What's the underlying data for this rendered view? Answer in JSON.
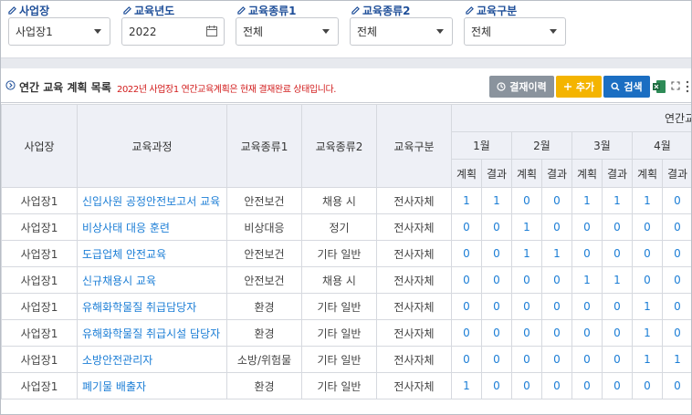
{
  "filters": [
    {
      "label": "사업장",
      "value": "사업장1",
      "type": "select"
    },
    {
      "label": "교육년도",
      "value": "2022",
      "type": "date"
    },
    {
      "label": "교육종류1",
      "value": "전체",
      "type": "select"
    },
    {
      "label": "교육종류2",
      "value": "전체",
      "type": "select"
    },
    {
      "label": "교육구분",
      "value": "전체",
      "type": "select"
    }
  ],
  "section": {
    "title": "연간 교육 계획 목록",
    "note": "2022년 사업장1 연간교육계획은 현재 결재완료 상태입니다."
  },
  "buttons": {
    "history": "결재이력",
    "add": "추가",
    "search": "검색"
  },
  "table": {
    "headers": {
      "site": "사업장",
      "course": "교육과정",
      "type1": "교육종류1",
      "type2": "교육종류2",
      "category": "교육구분",
      "annual": "연간교"
    },
    "months": [
      "1월",
      "2월",
      "3월",
      "4월"
    ],
    "sub": {
      "plan": "계획",
      "result": "결과"
    },
    "rows": [
      {
        "site": "사업장1",
        "course": "신입사원 공정안전보고서 교육",
        "type1": "안전보건",
        "type2": "채용 시",
        "category": "전사자체",
        "vals": [
          "1",
          "1",
          "0",
          "0",
          "1",
          "1",
          "1",
          "0"
        ]
      },
      {
        "site": "사업장1",
        "course": "비상사태 대응 훈련",
        "type1": "비상대응",
        "type2": "정기",
        "category": "전사자체",
        "vals": [
          "0",
          "0",
          "1",
          "0",
          "0",
          "0",
          "0",
          "0"
        ]
      },
      {
        "site": "사업장1",
        "course": "도급업체 안전교육",
        "type1": "안전보건",
        "type2": "기타 일반",
        "category": "전사자체",
        "vals": [
          "0",
          "0",
          "1",
          "1",
          "0",
          "0",
          "0",
          "0"
        ]
      },
      {
        "site": "사업장1",
        "course": "신규채용시 교육",
        "type1": "안전보건",
        "type2": "채용 시",
        "category": "전사자체",
        "vals": [
          "0",
          "0",
          "0",
          "0",
          "1",
          "1",
          "0",
          "0"
        ]
      },
      {
        "site": "사업장1",
        "course": "유해화학물질 취급담당자",
        "type1": "환경",
        "type2": "기타 일반",
        "category": "전사자체",
        "vals": [
          "0",
          "0",
          "0",
          "0",
          "0",
          "0",
          "1",
          "0"
        ]
      },
      {
        "site": "사업장1",
        "course": "유해화학물질 취급시설 담당자",
        "type1": "환경",
        "type2": "기타 일반",
        "category": "전사자체",
        "vals": [
          "0",
          "0",
          "0",
          "0",
          "0",
          "0",
          "1",
          "0"
        ]
      },
      {
        "site": "사업장1",
        "course": "소방안전관리자",
        "type1": "소방/위험물",
        "type2": "기타 일반",
        "category": "전사자체",
        "vals": [
          "0",
          "0",
          "0",
          "0",
          "0",
          "0",
          "1",
          "1"
        ]
      },
      {
        "site": "사업장1",
        "course": "폐기물 배출자",
        "type1": "환경",
        "type2": "기타 일반",
        "category": "전사자체",
        "vals": [
          "1",
          "0",
          "0",
          "0",
          "0",
          "0",
          "0",
          "0"
        ]
      }
    ]
  }
}
